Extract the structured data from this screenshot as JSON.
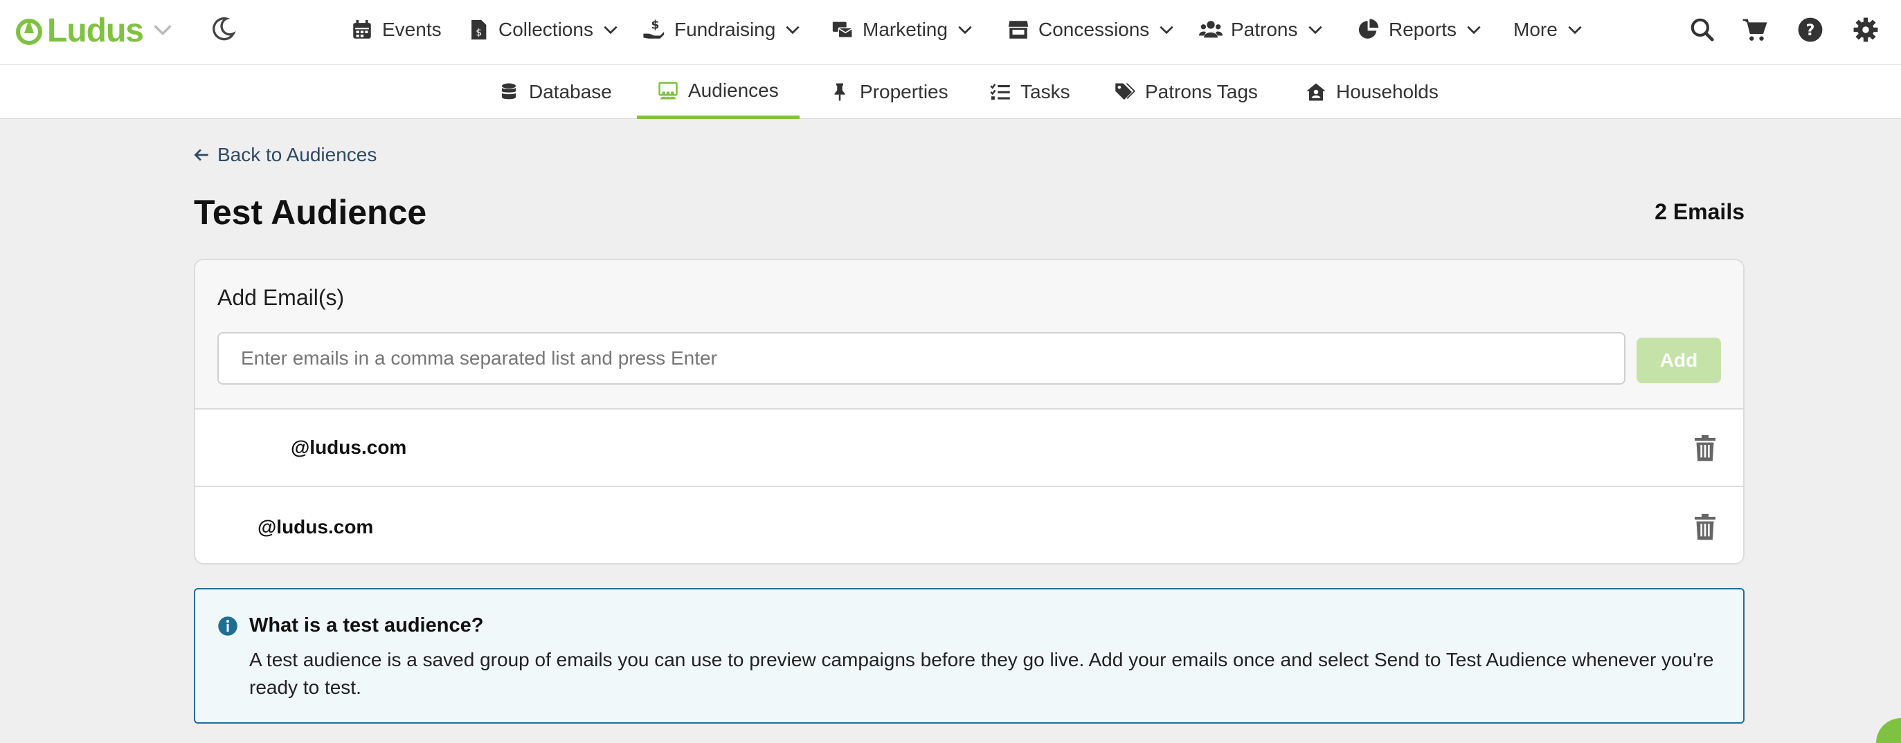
{
  "brand": {
    "name": "Ludus",
    "accent_color": "#7fc241"
  },
  "topnav": {
    "items": [
      {
        "label": "Events",
        "icon": "calendar-icon"
      },
      {
        "label": "Collections",
        "icon": "invoice-icon"
      },
      {
        "label": "Fundraising",
        "icon": "donate-hand-icon"
      },
      {
        "label": "Marketing",
        "icon": "mail-bulk-icon"
      },
      {
        "label": "Concessions",
        "icon": "store-icon"
      },
      {
        "label": "Patrons",
        "icon": "users-icon"
      },
      {
        "label": "Reports",
        "icon": "pie-chart-icon"
      },
      {
        "label": "More",
        "icon": ""
      }
    ],
    "utilities": [
      "search-icon",
      "cart-icon",
      "help-icon",
      "gear-icon"
    ]
  },
  "subnav": {
    "items": [
      {
        "label": "Database",
        "icon": "database-icon"
      },
      {
        "label": "Audiences",
        "icon": "audience-icon",
        "active": true
      },
      {
        "label": "Properties",
        "icon": "pin-icon"
      },
      {
        "label": "Tasks",
        "icon": "task-list-icon"
      },
      {
        "label": "Patrons Tags",
        "icon": "tags-icon"
      },
      {
        "label": "Households",
        "icon": "house-user-icon"
      }
    ]
  },
  "page": {
    "back_label": "Back to Audiences",
    "title": "Test Audience",
    "email_count": "2 Emails"
  },
  "add_card": {
    "title": "Add Email(s)",
    "input_placeholder": "Enter emails in a comma separated list and press Enter",
    "input_value": "",
    "add_label": "Add"
  },
  "emails": [
    {
      "address": "@ludus.com"
    },
    {
      "address": "@ludus.com"
    }
  ],
  "info": {
    "title": "What is a test audience?",
    "body": "A test audience is a saved group of emails you can use to preview campaigns before they go live. Add your emails once and select Send to Test Audience whenever you're ready to test."
  }
}
